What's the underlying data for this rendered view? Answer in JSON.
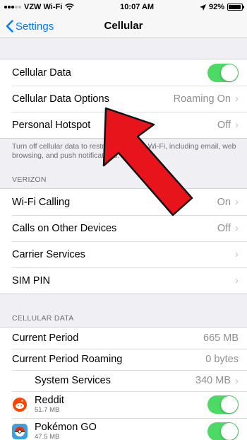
{
  "status": {
    "carrier": "VZW Wi-Fi",
    "time": "10:07 AM",
    "battery": "92%",
    "battery_level": 0.92
  },
  "nav": {
    "back_label": "Settings",
    "title": "Cellular"
  },
  "group1": [
    {
      "label": "Cellular Data",
      "toggle": true
    },
    {
      "label": "Cellular Data Options",
      "value": "Roaming On"
    },
    {
      "label": "Personal Hotspot",
      "value": "Off"
    }
  ],
  "footnote": "Turn off cellular data to restrict all data to Wi-Fi, including email, web browsing, and push notifications.",
  "verizon": {
    "header": "VERIZON",
    "rows": [
      {
        "label": "Wi-Fi Calling",
        "value": "On"
      },
      {
        "label": "Calls on Other Devices",
        "value": "Off"
      },
      {
        "label": "Carrier Services",
        "value": ""
      },
      {
        "label": "SIM PIN",
        "value": ""
      }
    ]
  },
  "cellular_data": {
    "header": "CELLULAR DATA",
    "rows": [
      {
        "label": "Current Period",
        "value": "665 MB"
      },
      {
        "label": "Current Period Roaming",
        "value": "0 bytes"
      },
      {
        "label": "System Services",
        "value": "340 MB"
      }
    ],
    "apps": [
      {
        "name": "Reddit",
        "size": "51.7 MB",
        "enabled": true
      },
      {
        "name": "Pokémon GO",
        "size": "47.5 MB",
        "enabled": true
      }
    ]
  },
  "colors": {
    "accent": "#007aff",
    "toggle_on": "#4cd964",
    "arrow": "#e8141b"
  },
  "icons": {
    "back": "chevron-left-icon",
    "disclosure": "chevron-right-icon",
    "wifi": "wifi-icon",
    "location": "location-arrow-icon"
  }
}
